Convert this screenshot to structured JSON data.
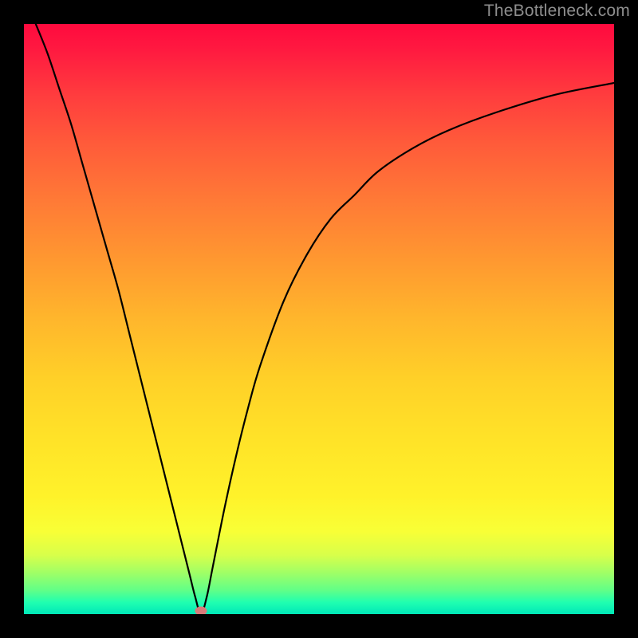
{
  "watermark": {
    "text": "TheBottleneck.com"
  },
  "chart_data": {
    "type": "line",
    "title": "",
    "xlabel": "",
    "ylabel": "",
    "xlim": [
      0,
      100
    ],
    "ylim": [
      0,
      100
    ],
    "grid": false,
    "legend": false,
    "background": "red-yellow-green vertical gradient",
    "series": [
      {
        "name": "bottleneck-curve",
        "x": [
          2,
          4,
          6,
          8,
          10,
          12,
          14,
          16,
          18,
          20,
          22,
          24,
          26,
          28,
          29,
          30,
          31,
          32,
          34,
          36,
          38,
          40,
          44,
          48,
          52,
          56,
          60,
          66,
          72,
          80,
          90,
          100
        ],
        "values": [
          100,
          95,
          89,
          83,
          76,
          69,
          62,
          55,
          47,
          39,
          31,
          23,
          15,
          7,
          3,
          0,
          3,
          8,
          18,
          27,
          35,
          42,
          53,
          61,
          67,
          71,
          75,
          79,
          82,
          85,
          88,
          90
        ]
      }
    ],
    "marker": {
      "x": 30,
      "y": 0,
      "color": "#d87a7a"
    }
  }
}
